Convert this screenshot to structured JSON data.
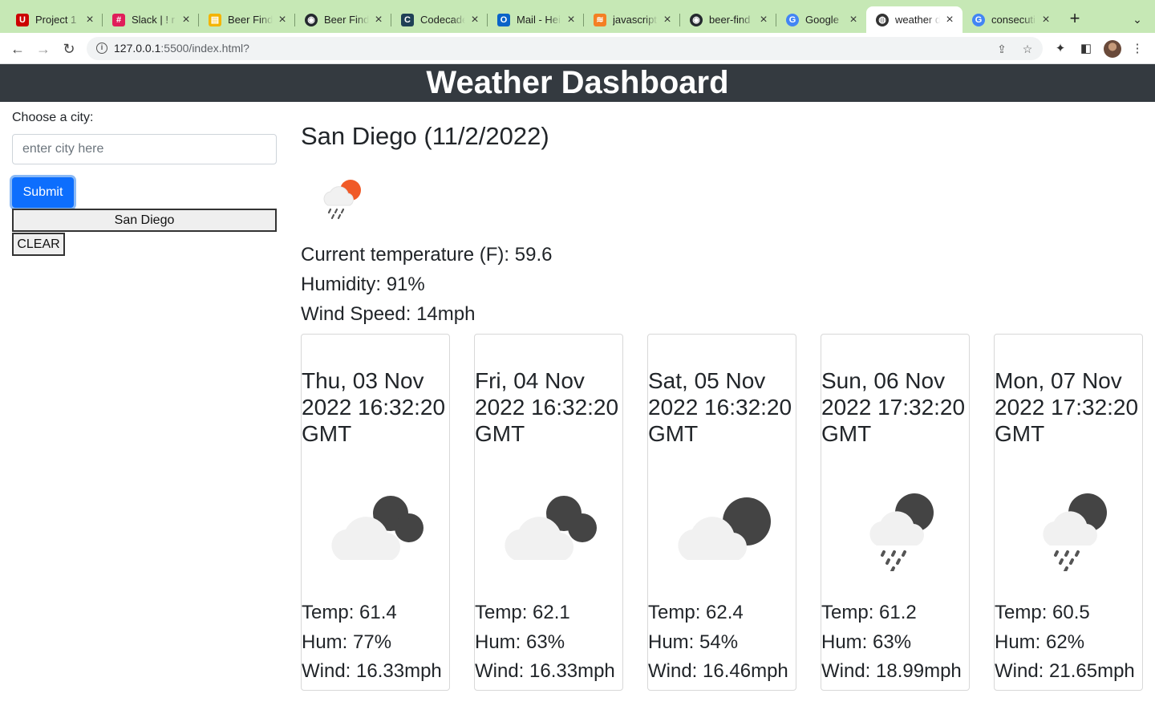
{
  "browser": {
    "tabs": [
      {
        "label": "Project 1",
        "icon": "U",
        "color": "#cc0000"
      },
      {
        "label": "Slack | ! r",
        "icon": "#",
        "color": "#e01e5a"
      },
      {
        "label": "Beer Find",
        "icon": "▤",
        "color": "#f4b400"
      },
      {
        "label": "Beer Find",
        "icon": "◉",
        "color": "#24292e"
      },
      {
        "label": "Codecade",
        "icon": "C",
        "color": "#1f4056"
      },
      {
        "label": "Mail - Hei",
        "icon": "O",
        "color": "#0a64c8"
      },
      {
        "label": "javascript",
        "icon": "≋",
        "color": "#f48024"
      },
      {
        "label": "beer-find",
        "icon": "◉",
        "color": "#24292e"
      },
      {
        "label": "Google",
        "icon": "G",
        "color": "#4285f4"
      },
      {
        "label": "weather d",
        "icon": "◍",
        "color": "#333333"
      },
      {
        "label": "consecuti",
        "icon": "G",
        "color": "#4285f4"
      }
    ],
    "url_host": "127.0.0.1",
    "url_rest": ":5500/index.html?"
  },
  "app": {
    "title": "Weather Dashboard",
    "choose_label": "Choose a city:",
    "input_placeholder": "enter city here",
    "input_value": "",
    "submit_label": "Submit",
    "history": [
      "San Diego"
    ],
    "clear_label": "CLEAR"
  },
  "current": {
    "heading": "San Diego (11/2/2022)",
    "icon": "rain-partly-sunny-icon",
    "temp": "Current temperature (F): 59.6",
    "humidity": "Humidity: 91%",
    "wind": "Wind Speed: 14mph"
  },
  "forecast": [
    {
      "date": "Thu, 03 Nov 2022 16:32:20 GMT",
      "icon": "cloudy-night-icon",
      "temp": "Temp: 61.4",
      "hum": "Hum: 77%",
      "wind": "Wind: 16.33mph"
    },
    {
      "date": "Fri, 04 Nov 2022 16:32:20 GMT",
      "icon": "cloudy-night-icon",
      "temp": "Temp: 62.1",
      "hum": "Hum: 63%",
      "wind": "Wind: 16.33mph"
    },
    {
      "date": "Sat, 05 Nov 2022 16:32:20 GMT",
      "icon": "partly-cloudy-night-icon",
      "temp": "Temp: 62.4",
      "hum": "Hum: 54%",
      "wind": "Wind: 16.46mph"
    },
    {
      "date": "Sun, 06 Nov 2022 17:32:20 GMT",
      "icon": "rain-night-icon",
      "temp": "Temp: 61.2",
      "hum": "Hum: 63%",
      "wind": "Wind: 18.99mph"
    },
    {
      "date": "Mon, 07 Nov 2022 17:32:20 GMT",
      "icon": "rain-night-icon",
      "temp": "Temp: 60.5",
      "hum": "Hum: 62%",
      "wind": "Wind: 21.65mph"
    }
  ]
}
